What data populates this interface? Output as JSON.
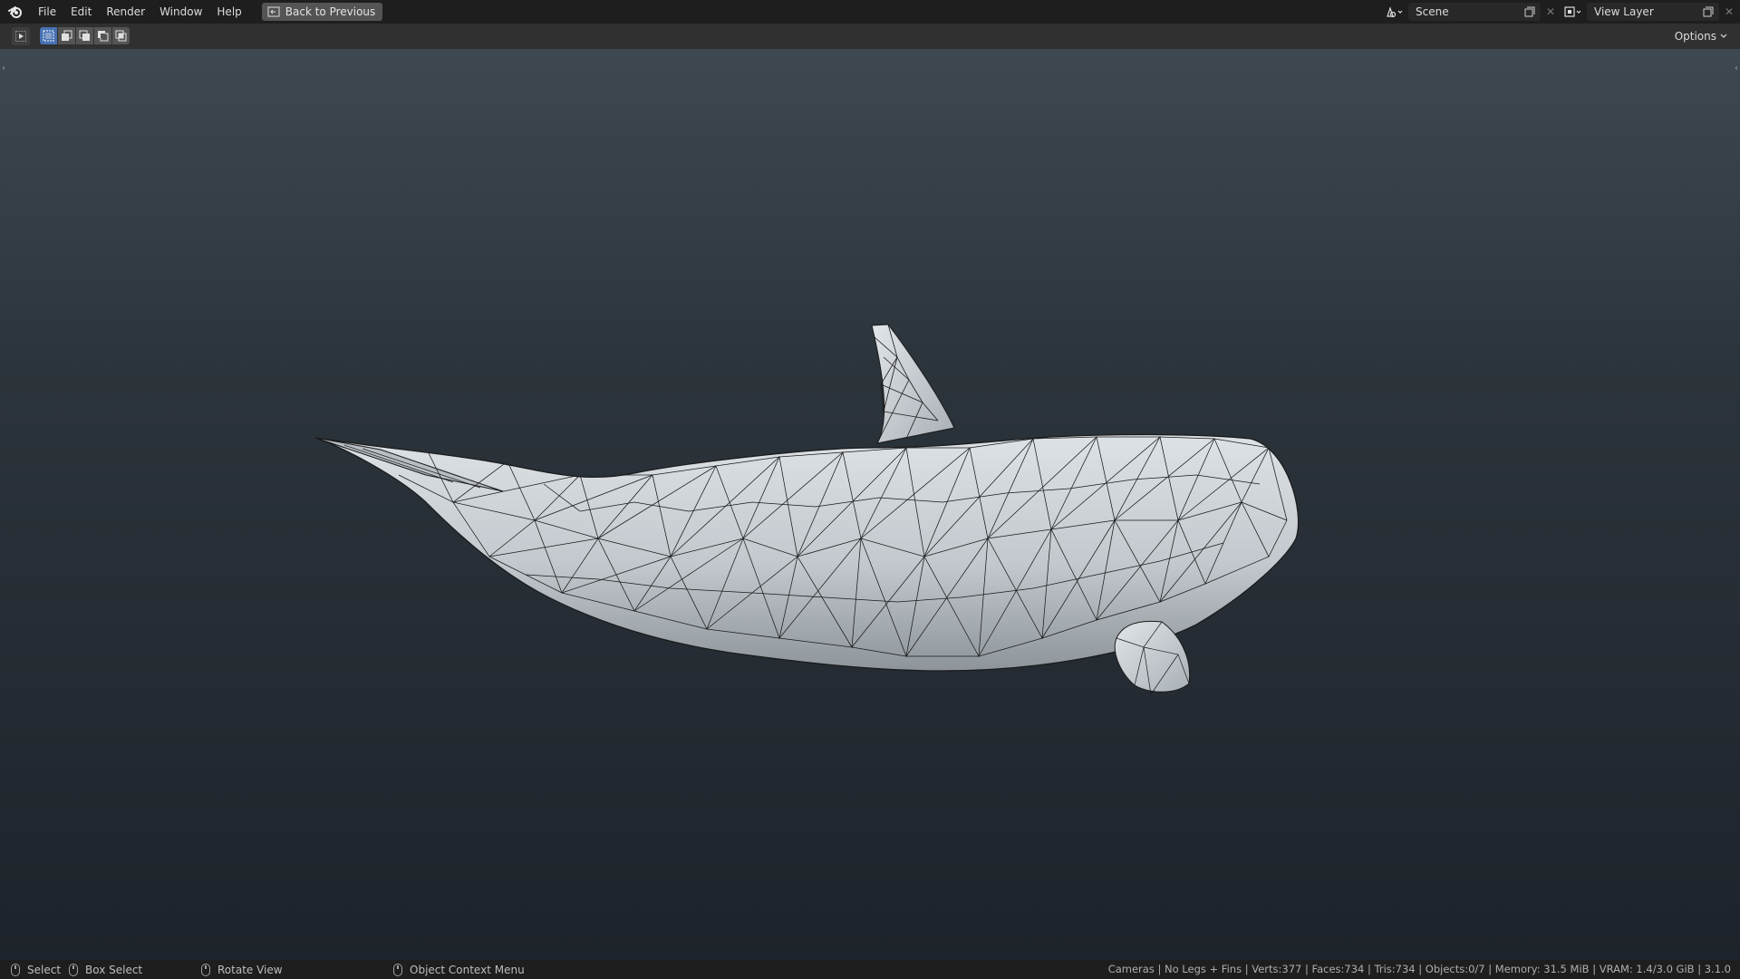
{
  "menu": {
    "items": [
      "File",
      "Edit",
      "Render",
      "Window",
      "Help"
    ],
    "back_button": "Back to Previous"
  },
  "scene": {
    "value": "Scene"
  },
  "view_layer": {
    "value": "View Layer"
  },
  "toolheader": {
    "options_label": "Options"
  },
  "statusbar": {
    "select": "Select",
    "box_select": "Box Select",
    "rotate_view": "Rotate View",
    "context_menu": "Object Context Menu",
    "stats": "Cameras | No Legs + Fins | Verts:377 | Faces:734 | Tris:734 | Objects:0/7 | Memory: 31.5 MiB | VRAM: 1.4/3.0 GiB | 3.1.0"
  },
  "colors": {
    "accent": "#4772b3",
    "viewport_top": "#3e4850",
    "viewport_bottom": "#1d232a",
    "mesh_fill": "#c9ced3",
    "wire": "#1a1a1a"
  },
  "icons": {
    "logo": "blender-logo-icon",
    "back": "back-to-previous-icon",
    "scene": "scene-icon",
    "view_layer": "view-layer-icon",
    "copy": "duplicate-icon",
    "close": "close-icon"
  }
}
